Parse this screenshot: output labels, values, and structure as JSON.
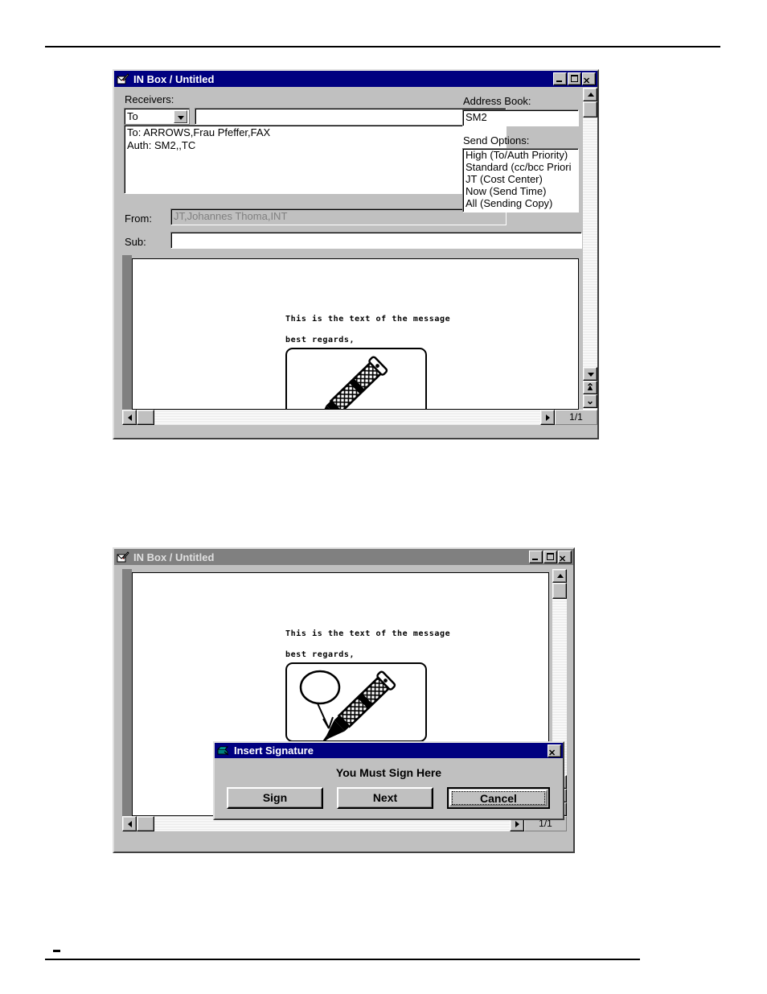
{
  "window1": {
    "title": "IN Box / Untitled",
    "icon": "mail-write-icon",
    "titlebar_state": "active",
    "buttons": {
      "minimize": "_",
      "maximize": "□",
      "close": "✕"
    },
    "labels": {
      "receivers": "Receivers:",
      "address_book": "Address Book:",
      "send_options": "Send Options:",
      "from": "From:",
      "sub": "Sub:"
    },
    "recipient_type": "To",
    "recipient_input": "",
    "recipient_list": "To: ARROWS,Frau Pfeffer,FAX\nAuth: SM2,,TC",
    "address_book_value": "SM2",
    "send_options": [
      "High   (To/Auth Priority)",
      "Standard   (cc/bcc Priori",
      "JT   (Cost Center)",
      "Now   (Send Time)",
      "All   (Sending Copy)"
    ],
    "from_value": "JT,Johannes Thoma,INT",
    "sub_value": "",
    "body": {
      "line1": "This is the text of the message",
      "line2": "best regards,",
      "signature_content": "pen-illustration"
    },
    "page_indicator": "1/1"
  },
  "window2": {
    "title": "IN Box / Untitled",
    "icon": "mail-write-icon",
    "titlebar_state": "inactive",
    "buttons": {
      "minimize": "_",
      "maximize": "□",
      "close": "✕"
    },
    "body": {
      "line1": "This is the text of the message",
      "line2": "best regards,",
      "signature_content": "pen-and-signed-mark-illustration"
    },
    "page_indicator": "1/1"
  },
  "dialog": {
    "title": "Insert Signature",
    "icon": "signature-pen-icon",
    "close_label": "✕",
    "message": "You Must Sign Here",
    "buttons": [
      {
        "label": "Sign",
        "default": false
      },
      {
        "label": "Next",
        "default": false
      },
      {
        "label": "Cancel",
        "default": true
      }
    ]
  },
  "colors": {
    "titlebar_active": "#000080",
    "titlebar_inactive": "#808080",
    "face": "#c0c0c0",
    "window_bg": "#ffffff"
  }
}
